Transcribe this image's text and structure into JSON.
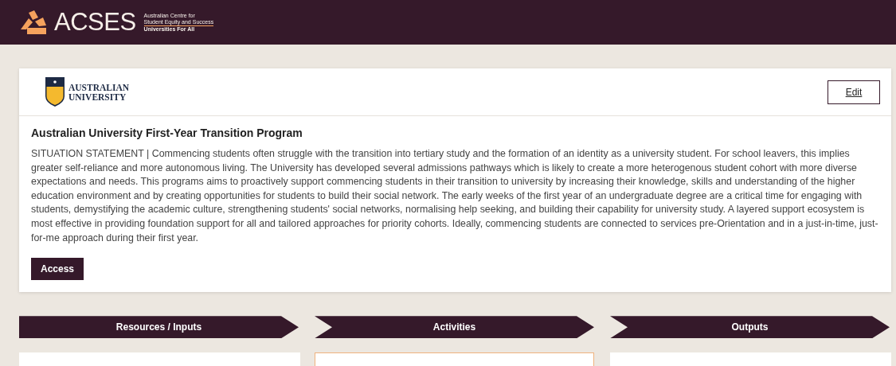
{
  "header": {
    "brand": "ACSES",
    "tagline_lines": [
      "Australian Centre for",
      "Student Equity and Success"
    ],
    "subtitle": "Universities For All"
  },
  "program": {
    "institution": [
      "AUSTRALIAN",
      "UNIVERSITY"
    ],
    "edit_button": "Edit",
    "title": "Australian University First-Year Transition Program",
    "statement": "SITUATION STATEMENT | Commencing students often struggle with the transition into tertiary study and the formation of an identity as a university student. For school leavers, this implies greater self-reliance and more autonomous living. The University has developed several admissions pathways which is likely to create a more heterogenous student cohort with more diverse expectations and needs.  This programs aims to proactively support commencing students in their transition to university by increasing their knowledge, skills and understanding of the higher education environment and by creating opportunities for students to build their social network. The early weeks of the first year of an undergraduate degree are a critical time for engaging with students, demystifying the academic culture, strengthening students' social networks, normalising help seeking, and building their capability for university study. A layered support ecosystem is most effective in providing foundation support for all and tailored approaches for priority cohorts. Ideally, commencing students are connected to services pre-Orientation and in a just-in-time, just-for-me approach during their first year.",
    "access_button": "Access"
  },
  "stages": [
    {
      "label": "Resources / Inputs",
      "selected": false
    },
    {
      "label": "Activities",
      "selected": true
    },
    {
      "label": "Outputs",
      "selected": false
    }
  ]
}
